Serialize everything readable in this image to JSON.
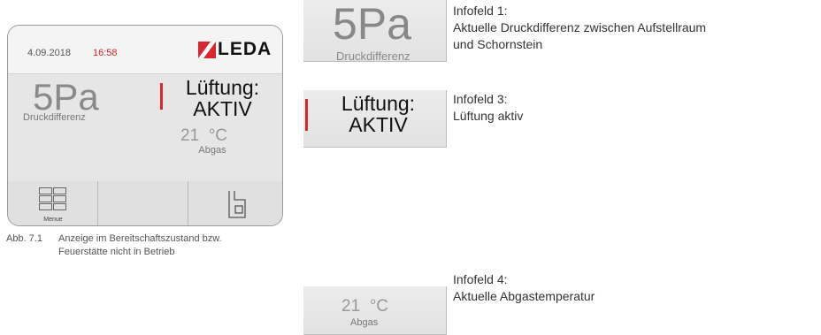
{
  "device": {
    "date": "4.09.2018",
    "time": "16:58",
    "logo": "LEDA",
    "pressure": "5Pa",
    "pressure_label": "Druckdifferenz",
    "ventilation_line1": "Lüftung:",
    "ventilation_line2": "AKTIV",
    "temperature": "21  °C",
    "temperature_label": "Abgas",
    "menu_label": "Menue",
    "accent_color": "#d8282f"
  },
  "caption": {
    "figure": "Abb. 7.1",
    "line1": "Anzeige im Bereitschaftszustand bzw.",
    "line2": "Feuerstätte nicht in Betrieb"
  },
  "info_fields": {
    "field1": {
      "value": "5Pa",
      "label": "Druckdifferenz",
      "title": "Infofeld 1:",
      "desc_line1": "Aktuelle Druckdifferenz zwischen Aufstellraum",
      "desc_line2": "und Schornstein"
    },
    "field3": {
      "line1": "Lüftung:",
      "line2": "AKTIV",
      "title": "Infofeld 3:",
      "desc_line1": "Lüftung aktiv"
    },
    "field4": {
      "value": "21  °C",
      "label": "Abgas",
      "title": "Infofeld 4:",
      "desc_line1": "Aktuelle Abgastemperatur"
    }
  }
}
